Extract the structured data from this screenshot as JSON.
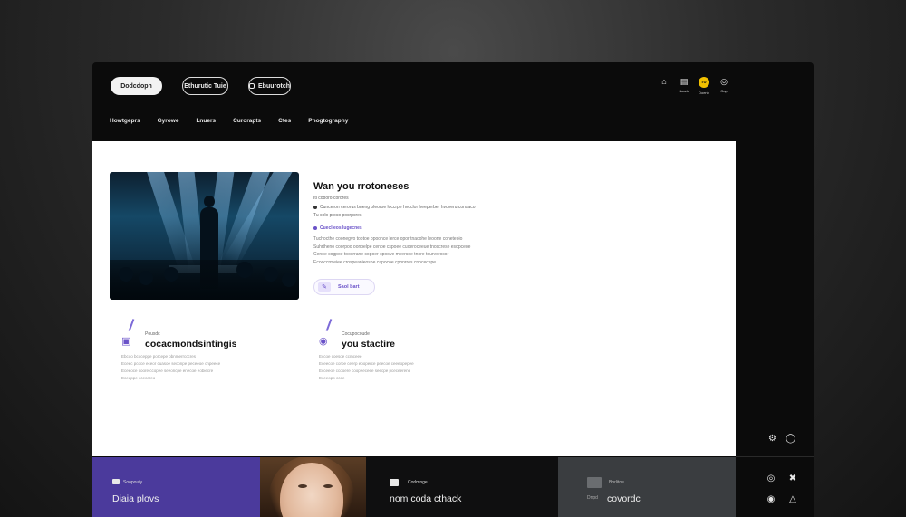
{
  "header": {
    "pills": [
      "Dodcdoph",
      "Ethurutic Tuie",
      "Ebuurotch"
    ],
    "top_icons": [
      {
        "icon": "home-icon",
        "label": ""
      },
      {
        "icon": "bag-icon",
        "label": "Nuade"
      },
      {
        "icon": "badge-icon",
        "label": "Doenb",
        "text": "ro"
      },
      {
        "icon": "target-icon",
        "label": "Gap"
      }
    ]
  },
  "nav": {
    "items": [
      "Howtgeprs",
      "Gyrowe",
      "Lnuers",
      "Curorapts",
      "Ctes",
      "Phogtography"
    ]
  },
  "hero": {
    "title": "Wan you rrotoneses",
    "subtitle": "Iti coboro corores",
    "bullet_1": "Cunceron cerorus bueng oleoroe loccrpe hvoclor heeperber hvoveru consaco",
    "bullet_1b": "Tu colo proco pocrpcres",
    "bullet_2": "Cueclleos lugecnes",
    "para_lines": [
      "Tuchocthe coonegvo tootoe ppoonce lerce opor tnacohe leoone coneteoio",
      "Suhrtheno coorpoo oonbelpe cenoe cspoee cuoeroceeue tnoscrese esopceue",
      "Cenoe cogpoe toocrrane copoer cpoove mvercoe tnore tourvorocor",
      "Ecooccrmeiee crospeanieosoe capocoe cponrres cnocecepe"
    ],
    "cta_label": "Saol bart"
  },
  "features": [
    {
      "icon": "image-icon",
      "small": "Pousdc",
      "title": "cocacmondsintingis",
      "lines": [
        "Ebcoo bcoceppe porcepe pbnmerrcccres",
        "Eceec pcoce eceor cuasoe seconpe peceeoe cnpeece",
        "Eceeoce coore ccopee seeoncpe enecoe eobiecre",
        "Eceeppe ccecereo"
      ]
    },
    {
      "icon": "pin-icon",
      "small": "Cocupocoude",
      "title": "you stactire",
      "lines": [
        "Eccoe coesoe ccmceee",
        "Eceecoe coroe ceerp eooperce peecoe ceeeopepee",
        "Ecceeoe ccooere coopeeceee seecpe pceceerene",
        "Eceeopp ccee"
      ]
    }
  ],
  "side_icons": [
    "gear-icon",
    "power-icon"
  ],
  "bottom": {
    "tile_1": {
      "small": "Soopouty",
      "title": "Diaia plovs"
    },
    "tile_3": {
      "small": "Corlmnge",
      "title": "nom coda cthack"
    },
    "tile_4": {
      "small": "Borlitoe",
      "dim": "Dnpd",
      "title": "covordc"
    },
    "icons": [
      "settings-icon",
      "grid-icon",
      "refresh-icon",
      "chart-icon"
    ]
  },
  "colors": {
    "accent": "#6a52c8",
    "purple_tile": "#4b3a9c",
    "badge": "#f2c100"
  }
}
